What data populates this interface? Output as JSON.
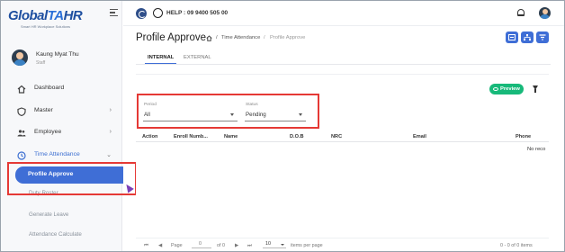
{
  "brand": {
    "logo_main": "Global",
    "logo_accent": "TA",
    "logo_suffix": "HR",
    "tagline": "Smart HR Workplace Solutions",
    "accent_color": "#3f6ed6"
  },
  "user": {
    "name": "Kaung Myat Thu",
    "role": "Staff"
  },
  "sidebar": {
    "items": [
      {
        "label": "Dashboard",
        "icon": "home-icon"
      },
      {
        "label": "Master",
        "icon": "shield-icon",
        "chevron": "›"
      },
      {
        "label": "Employee",
        "icon": "people-icon",
        "chevron": "›"
      },
      {
        "label": "Time Attendance",
        "icon": "clock-icon",
        "chevron": "⌄"
      }
    ],
    "subitems": [
      {
        "label": "Profile Approve"
      },
      {
        "label": "Duty Roster"
      },
      {
        "label": "Generate Leave"
      },
      {
        "label": "Attendance Calculate"
      }
    ]
  },
  "topbar": {
    "help_text": "HELP : 09 9400 505 00"
  },
  "page": {
    "title": "Profile Approve",
    "breadcrumb": [
      "Time Attendance",
      "Profile Approve"
    ],
    "separator": "/"
  },
  "tabs": [
    {
      "label": "INTERNAL",
      "active": true
    },
    {
      "label": "EXTERNAL",
      "active": false
    }
  ],
  "toolbar": {
    "preview_label": "Preview"
  },
  "filters": {
    "period": {
      "label": "Period",
      "value": "All"
    },
    "status": {
      "label": "Status",
      "value": "Pending"
    }
  },
  "table": {
    "columns": [
      "Action",
      "Enroll Numb...",
      "Name",
      "D.O.B",
      "NRC",
      "Email",
      "Phone"
    ],
    "empty_text": "No reco"
  },
  "pagination": {
    "page_label": "Page",
    "page_value": "0",
    "of_label": "of 0",
    "page_size": "10",
    "page_size_suffix": "items per page",
    "range_text": "0 - 0 of 0 items"
  }
}
